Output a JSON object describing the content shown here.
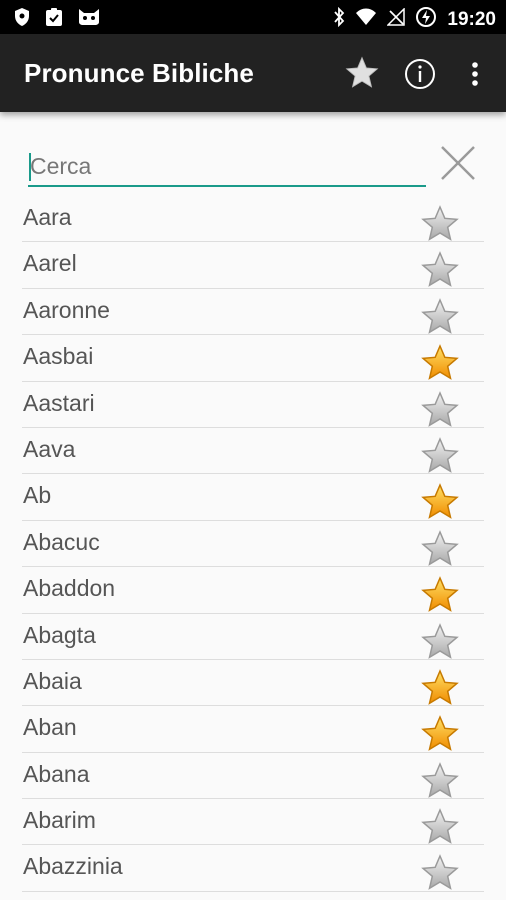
{
  "status_bar": {
    "time": "19:20",
    "icons": [
      "shield-icon",
      "clipboard-check-icon",
      "android-cat-icon",
      "bluetooth-icon",
      "wifi-icon",
      "no-signal-icon",
      "battery-charging-icon"
    ]
  },
  "app_bar": {
    "title": "Pronunce Bibliche",
    "actions": [
      "star-icon",
      "info-icon",
      "overflow-menu-icon"
    ]
  },
  "search": {
    "placeholder": "Cerca",
    "value": "",
    "accent_color": "#1a9a8a"
  },
  "list": {
    "items": [
      {
        "label": "Aara",
        "favorite": false
      },
      {
        "label": "Aarel",
        "favorite": false
      },
      {
        "label": "Aaronne",
        "favorite": false
      },
      {
        "label": "Aasbai",
        "favorite": true
      },
      {
        "label": "Aastari",
        "favorite": false
      },
      {
        "label": "Aava",
        "favorite": false
      },
      {
        "label": "Ab",
        "favorite": true
      },
      {
        "label": "Abacuc",
        "favorite": false
      },
      {
        "label": "Abaddon",
        "favorite": true
      },
      {
        "label": "Abagta",
        "favorite": false
      },
      {
        "label": "Abaia",
        "favorite": true
      },
      {
        "label": "Aban",
        "favorite": true
      },
      {
        "label": "Abana",
        "favorite": false
      },
      {
        "label": "Abarim",
        "favorite": false
      },
      {
        "label": "Abazzinia",
        "favorite": false
      }
    ]
  },
  "colors": {
    "app_bar_bg": "#222222",
    "status_bar_bg": "#000000",
    "star_favorite": "#f5a623",
    "star_default": "#c8c8c8"
  }
}
